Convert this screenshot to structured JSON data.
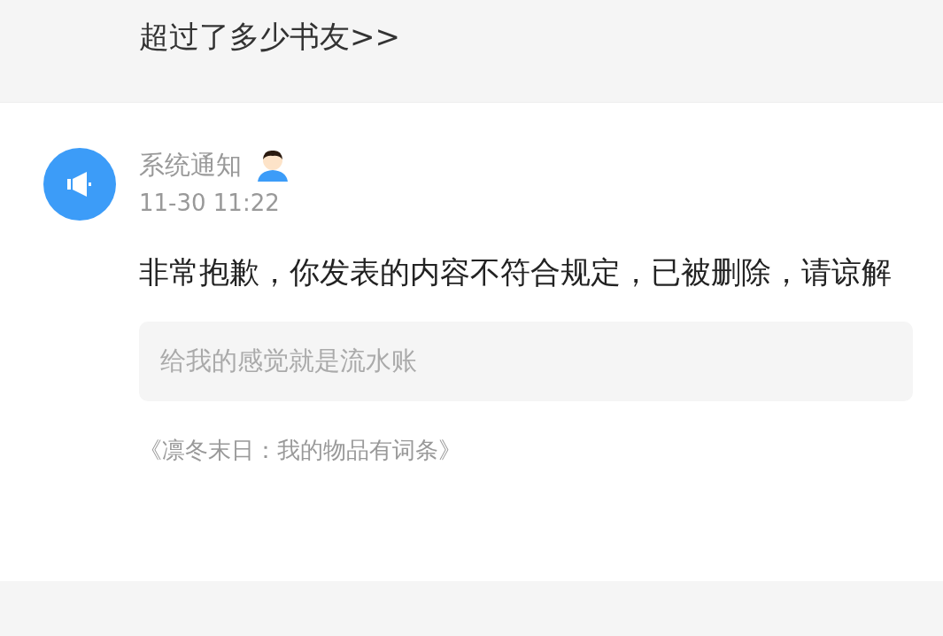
{
  "previous_item": {
    "link": "超过了多少书友>>"
  },
  "notification": {
    "sender": "系统通知",
    "time": "11-30 11:22",
    "message": "非常抱歉，你发表的内容不符合规定，已被删除，请谅解",
    "quote": "给我的感觉就是流水账",
    "book": "《凛冬末日：我的物品有词条》"
  }
}
